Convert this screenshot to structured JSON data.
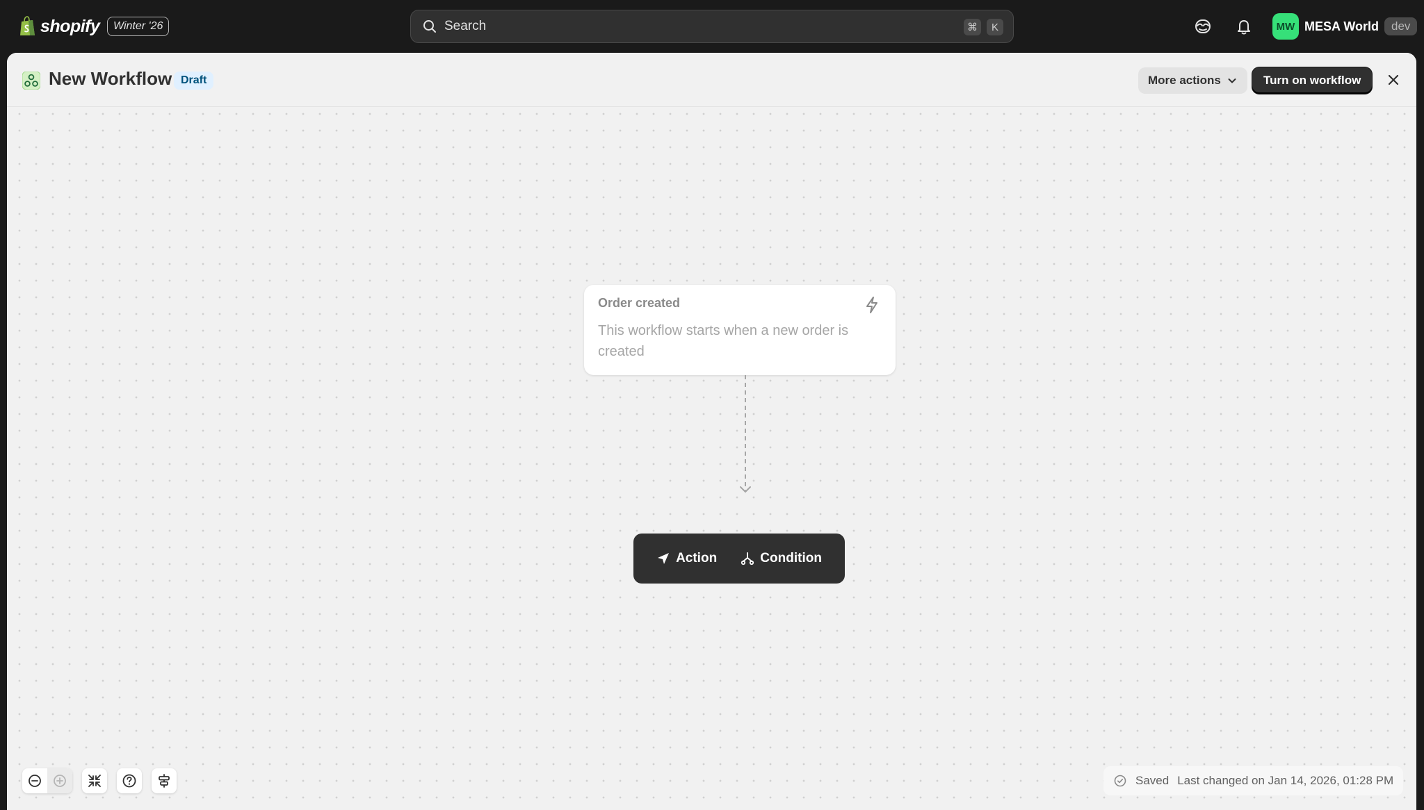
{
  "topbar": {
    "brand": "shopify",
    "edition": "Winter '26",
    "search_placeholder": "Search",
    "shortcut_cmd": "⌘",
    "shortcut_key": "K",
    "store_initials": "MW",
    "store_name": "MESA World",
    "env_badge": "dev"
  },
  "header": {
    "title": "New Workflow",
    "status_badge": "Draft",
    "more_actions_label": "More actions",
    "primary_label": "Turn on workflow"
  },
  "canvas": {
    "trigger": {
      "title": "Order created",
      "description": "This workflow starts when a new order is created"
    },
    "step_buttons": {
      "action_label": "Action",
      "condition_label": "Condition"
    }
  },
  "footer": {
    "saved_label": "Saved",
    "last_changed": "Last changed on Jan 14, 2026, 01:28 PM"
  },
  "icons": {
    "brand": "shopify-bag-icon",
    "search": "search-icon",
    "sidekick": "sidekick-icon",
    "notifications": "bell-icon",
    "workflow": "flow-app-icon",
    "more_actions": "chevron-down-icon",
    "close": "close-icon",
    "trigger": "lightning-bolt-icon",
    "action": "send-arrow-icon",
    "condition": "branch-icon",
    "zoom_out": "zoom-out-icon",
    "zoom_in": "zoom-in-icon",
    "fit_view": "fit-view-icon",
    "help": "help-icon",
    "layout": "layout-icon",
    "saved": "check-circle-icon"
  },
  "colors": {
    "topbar_bg": "#1a1a1a",
    "avatar_bg": "#36e079",
    "draft_badge_bg": "#e0f0ff",
    "primary_button_bg": "#303030"
  }
}
